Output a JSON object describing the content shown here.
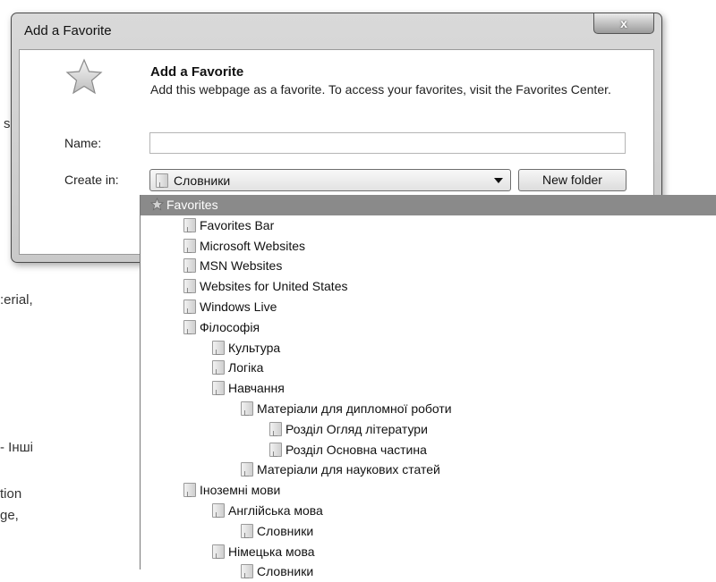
{
  "background_text": [
    {
      "id": "bg-s",
      "text": "s"
    },
    {
      "id": "bg-erial",
      "text": ":erial,"
    },
    {
      "id": "bg-inshi",
      "text": "- Інші"
    },
    {
      "id": "bg-tion",
      "text": "tion"
    },
    {
      "id": "bg-ge",
      "text": "ge,"
    }
  ],
  "dialog": {
    "window_title": "Add a Favorite",
    "close_glyph": "x",
    "header_title": "Add a Favorite",
    "header_description": "Add this webpage as a favorite. To access your favorites, visit the Favorites Center.",
    "name_label": "Name:",
    "name_value": "",
    "create_in_label": "Create in:",
    "create_in_value": "Словники",
    "new_folder_label": "New folder"
  },
  "tree": [
    {
      "label": "Favorites",
      "level": 0,
      "icon": "star-icon",
      "selected": true
    },
    {
      "label": "Favorites Bar",
      "level": 1,
      "icon": "folder-icon"
    },
    {
      "label": "Microsoft Websites",
      "level": 1,
      "icon": "folder-icon"
    },
    {
      "label": "MSN Websites",
      "level": 1,
      "icon": "folder-icon"
    },
    {
      "label": "Websites for United States",
      "level": 1,
      "icon": "folder-icon"
    },
    {
      "label": "Windows Live",
      "level": 1,
      "icon": "folder-icon"
    },
    {
      "label": "Філософія",
      "level": 1,
      "icon": "folder-icon"
    },
    {
      "label": "Культура",
      "level": 2,
      "icon": "folder-icon"
    },
    {
      "label": "Логіка",
      "level": 2,
      "icon": "folder-icon"
    },
    {
      "label": "Навчання",
      "level": 2,
      "icon": "folder-icon"
    },
    {
      "label": "Матеріали для дипломної роботи",
      "level": 3,
      "icon": "folder-icon"
    },
    {
      "label": "Розділ Огляд літератури",
      "level": 4,
      "icon": "folder-icon"
    },
    {
      "label": "Розділ Основна частина",
      "level": 4,
      "icon": "folder-icon"
    },
    {
      "label": "Матеріали для наукових статей",
      "level": 3,
      "icon": "folder-icon"
    },
    {
      "label": "Іноземні мови",
      "level": 1,
      "icon": "folder-icon"
    },
    {
      "label": "Англійська мова",
      "level": 2,
      "icon": "folder-icon"
    },
    {
      "label": "Словники",
      "level": 3,
      "icon": "folder-icon"
    },
    {
      "label": "Німецька мова",
      "level": 2,
      "icon": "folder-icon"
    },
    {
      "label": "Словники",
      "level": 3,
      "icon": "folder-icon"
    }
  ]
}
